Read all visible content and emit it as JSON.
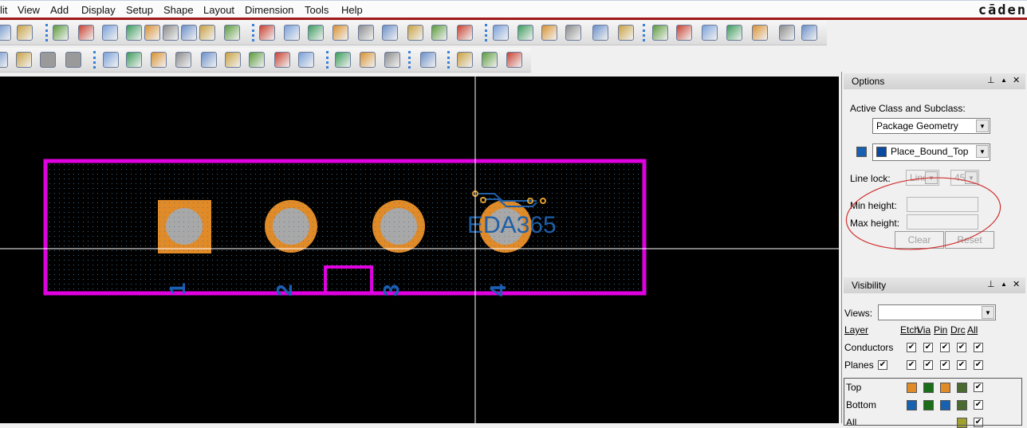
{
  "menu": [
    "lit",
    "View",
    "Add",
    "Display",
    "Setup",
    "Shape",
    "Layout",
    "Dimension",
    "Tools",
    "Help"
  ],
  "brand": "cāden",
  "toolbar1": [
    "open-icon",
    "save-icon",
    "move-icon",
    "copy-icon",
    "delete-icon",
    "undo-icon",
    "down-arrow-icon",
    "redo-icon",
    "down-arrow-icon",
    "leaf-icon",
    "pin-icon",
    "zoom-points-icon",
    "zoom-fit-icon",
    "zoom-in-icon",
    "zoom-out-icon",
    "zoom-previous-icon",
    "zoom-world-icon",
    "redraw-icon",
    "3d-view-icon",
    "flip-icon",
    "grid-icon",
    "color-icon",
    "layer-priority-icon",
    "stack-icon",
    "constraint-manager-icon",
    "globe-icon",
    "info-icon",
    "show-element-icon",
    "measure-icon",
    "hourglass-icon",
    "add-circle-icon",
    "r1-icon",
    "cursor-monitor-icon"
  ],
  "toolbar2": [
    "shape-icon",
    "board-icon",
    "blank-icon",
    "blank-icon",
    "l-shape-icon",
    "rectangle-icon",
    "circle-icon",
    "select-icon",
    "merge-shape-icon",
    "rotate-shape-icon",
    "square-outline-icon",
    "circle-outline-icon",
    "void-icon",
    "component-icon",
    "dimension-icon",
    "linear-dim-icon",
    "camera-icon",
    "copy-doc-icon",
    "mail-icon",
    "help-icon"
  ],
  "canvas": {
    "pins": [
      "1",
      "2",
      "3",
      "4"
    ],
    "watermark": "EDA365"
  },
  "options": {
    "title": "Options",
    "active_label": "Active Class and Subclass:",
    "class_value": "Package Geometry",
    "subclass_value": "Place_Bound_Top",
    "line_lock_label": "Line lock:",
    "line_lock_value": "Line",
    "angle_value": "45",
    "min_height_label": "Min height:",
    "max_height_label": "Max height:",
    "clear": "Clear",
    "reset": "Reset",
    "pin_glyph": "ᵖ",
    "up_glyph": "▲",
    "close_glyph": "✕"
  },
  "visibility": {
    "title": "Visibility",
    "views_label": "Views:",
    "views_value": "",
    "layer": "Layer",
    "cols": [
      "Etch",
      "Via",
      "Pin",
      "Drc",
      "All"
    ],
    "rows": [
      {
        "name": "Conductors",
        "checks": [
          true,
          true,
          true,
          true,
          true
        ]
      },
      {
        "name": "Planes",
        "checks": [
          true,
          true,
          true,
          true,
          true
        ],
        "self": true
      }
    ],
    "layers": [
      {
        "name": "Top",
        "colors": [
          "#e08a28",
          "#1a6e1a",
          "#e08a28",
          "#4a6a30"
        ],
        "all": true
      },
      {
        "name": "Bottom",
        "colors": [
          "#1860b0",
          "#1a6e1a",
          "#1860b0",
          "#4a6a30"
        ],
        "all": true
      },
      {
        "name": "All",
        "colors": [
          null,
          null,
          null,
          "#a0a030"
        ],
        "all": true
      }
    ]
  },
  "colors": {
    "outline": "#e000e0",
    "pad": "#e08a28",
    "drill": "#a8a8a8",
    "pin_label": "#1a5fb4",
    "annotation": "#d03030"
  }
}
